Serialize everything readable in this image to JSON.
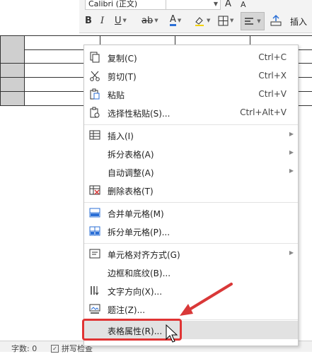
{
  "ribbon": {
    "font_name": "Calibri (正文)",
    "insert_label": "插入",
    "icons": [
      "bold-icon",
      "italic-icon",
      "underline-icon",
      "strikethrough-icon",
      "font-color-icon",
      "highlight-icon",
      "border-icon",
      "align-icon",
      "insert-icon"
    ]
  },
  "statusbar": {
    "word_count": "字数: 0",
    "spell_check": "拼写检查"
  },
  "menu": {
    "items": [
      {
        "label": "复制(C)",
        "shortcut": "Ctrl+C",
        "icon": "copy-icon"
      },
      {
        "label": "剪切(T)",
        "shortcut": "Ctrl+X",
        "icon": "scissors-icon"
      },
      {
        "label": "粘贴",
        "shortcut": "Ctrl+V",
        "icon": "paste-icon"
      },
      {
        "label": "选择性粘贴(S)...",
        "shortcut": "Ctrl+Alt+V",
        "icon": "paste-special-icon"
      },
      {
        "label": "插入(I)",
        "shortcut": "",
        "icon": "table-insert-icon"
      },
      {
        "label": "拆分表格(A)",
        "shortcut": "",
        "icon": ""
      },
      {
        "label": "自动调整(A)",
        "shortcut": "",
        "icon": ""
      },
      {
        "label": "删除表格(T)",
        "shortcut": "",
        "icon": "delete-table-icon"
      },
      {
        "label": "合并单元格(M)",
        "shortcut": "",
        "icon": "merge-cells-icon"
      },
      {
        "label": "拆分单元格(P)...",
        "shortcut": "",
        "icon": "split-cells-icon"
      },
      {
        "label": "单元格对齐方式(G)",
        "shortcut": "",
        "icon": "cell-align-icon"
      },
      {
        "label": "边框和底纹(B)...",
        "shortcut": "",
        "icon": ""
      },
      {
        "label": "文字方向(X)...",
        "shortcut": "",
        "icon": "text-direction-icon"
      },
      {
        "label": "题注(Z)...",
        "shortcut": "",
        "icon": "caption-icon"
      },
      {
        "label": "表格属性(R)...",
        "shortcut": "",
        "icon": ""
      }
    ]
  },
  "colors": {
    "highlight_box": "#e03434",
    "arrow": "#d93838",
    "menu_hover": "#e2e2e2",
    "table_shade": "#cfcfcf"
  }
}
